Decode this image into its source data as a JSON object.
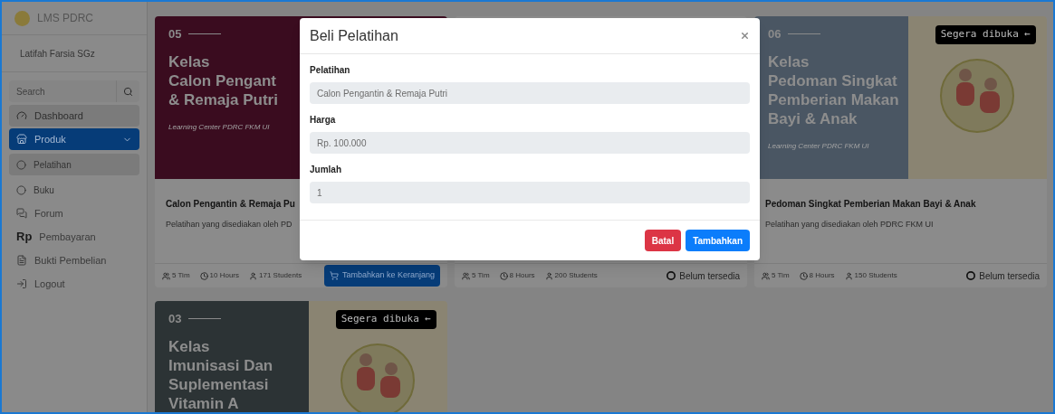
{
  "sidebar": {
    "brand": "LMS PDRC",
    "user": "Latifah Farsia SGz",
    "search": {
      "placeholder": "Search"
    },
    "items": [
      {
        "kind": "dashboard",
        "label": "Dashboard",
        "selected": false,
        "hovered": true
      },
      {
        "kind": "store",
        "label": "Produk",
        "selected": true,
        "hovered": false,
        "expanded": true,
        "children": [
          {
            "label": "Pelatihan",
            "selected": true
          },
          {
            "label": "Buku",
            "selected": false
          }
        ]
      },
      {
        "kind": "forum",
        "label": "Forum",
        "selected": false,
        "hovered": false
      },
      {
        "kind": "rupiah",
        "icon_text": "Rp",
        "label": "Pembayaran",
        "selected": false,
        "hovered": false
      },
      {
        "kind": "file",
        "label": "Bukti Pembelian",
        "selected": false,
        "hovered": false
      },
      {
        "kind": "logout",
        "label": "Logout",
        "selected": false,
        "hovered": false
      }
    ]
  },
  "cards": [
    {
      "cover": {
        "number": "05",
        "color": "#3a0c1f",
        "heading": [
          "Kelas",
          "Calon Pengant",
          "& Remaja Putri"
        ],
        "subtitle": "Learning Center PDRC FKM UI",
        "split": false
      },
      "title": "Calon Pengantin & Remaja Pu",
      "description": "Pelatihan yang disediakan oleh PD",
      "stats": [
        {
          "kind": "team",
          "text": "5 Tim"
        },
        {
          "kind": "hours",
          "text": "10 Hours"
        },
        {
          "kind": "students",
          "text": "171 Students"
        }
      ],
      "action": {
        "kind": "button",
        "label": "Tambahkan ke Keranjang"
      }
    },
    {
      "stats": [
        {
          "kind": "team",
          "text": "5 Tim"
        },
        {
          "kind": "hours",
          "text": "8 Hours"
        },
        {
          "kind": "students",
          "text": "200 Students"
        }
      ],
      "action": {
        "kind": "status",
        "label": "Belum tersedia"
      }
    },
    {
      "cover": {
        "number": "06",
        "color": "#4a5663",
        "heading": [
          "Kelas",
          "Pedoman Singkat",
          "Pemberian Makan",
          "Bayi & Anak"
        ],
        "subtitle": "Learning Center PDRC FKM UI",
        "split": true,
        "badge": "Segera dibuka ←"
      },
      "title": "Pedoman Singkat Pemberian Makan Bayi & Anak",
      "description": "Pelatihan yang disediakan oleh PDRC FKM UI",
      "stats": [
        {
          "kind": "team",
          "text": "5 Tim"
        },
        {
          "kind": "hours",
          "text": "8 Hours"
        },
        {
          "kind": "students",
          "text": "150 Students"
        }
      ],
      "action": {
        "kind": "status",
        "label": "Belum tersedia"
      }
    },
    {
      "cover": {
        "number": "03",
        "color": "#2c3335",
        "heading": [
          "Kelas",
          "Imunisasi Dan",
          "Suplementasi",
          "Vitamin A"
        ],
        "split": true,
        "badge": "Segera dibuka ←"
      }
    }
  ],
  "modal": {
    "title": "Beli Pelatihan",
    "fields": [
      {
        "label": "Pelatihan",
        "value": "Calon Pengantin & Remaja Putri"
      },
      {
        "label": "Harga",
        "value": "Rp. 100.000"
      },
      {
        "label": "Jumlah",
        "value": "1"
      }
    ],
    "buttons": [
      {
        "kind": "danger",
        "label": "Batal"
      },
      {
        "kind": "primary",
        "label": "Tambahkan"
      }
    ]
  }
}
